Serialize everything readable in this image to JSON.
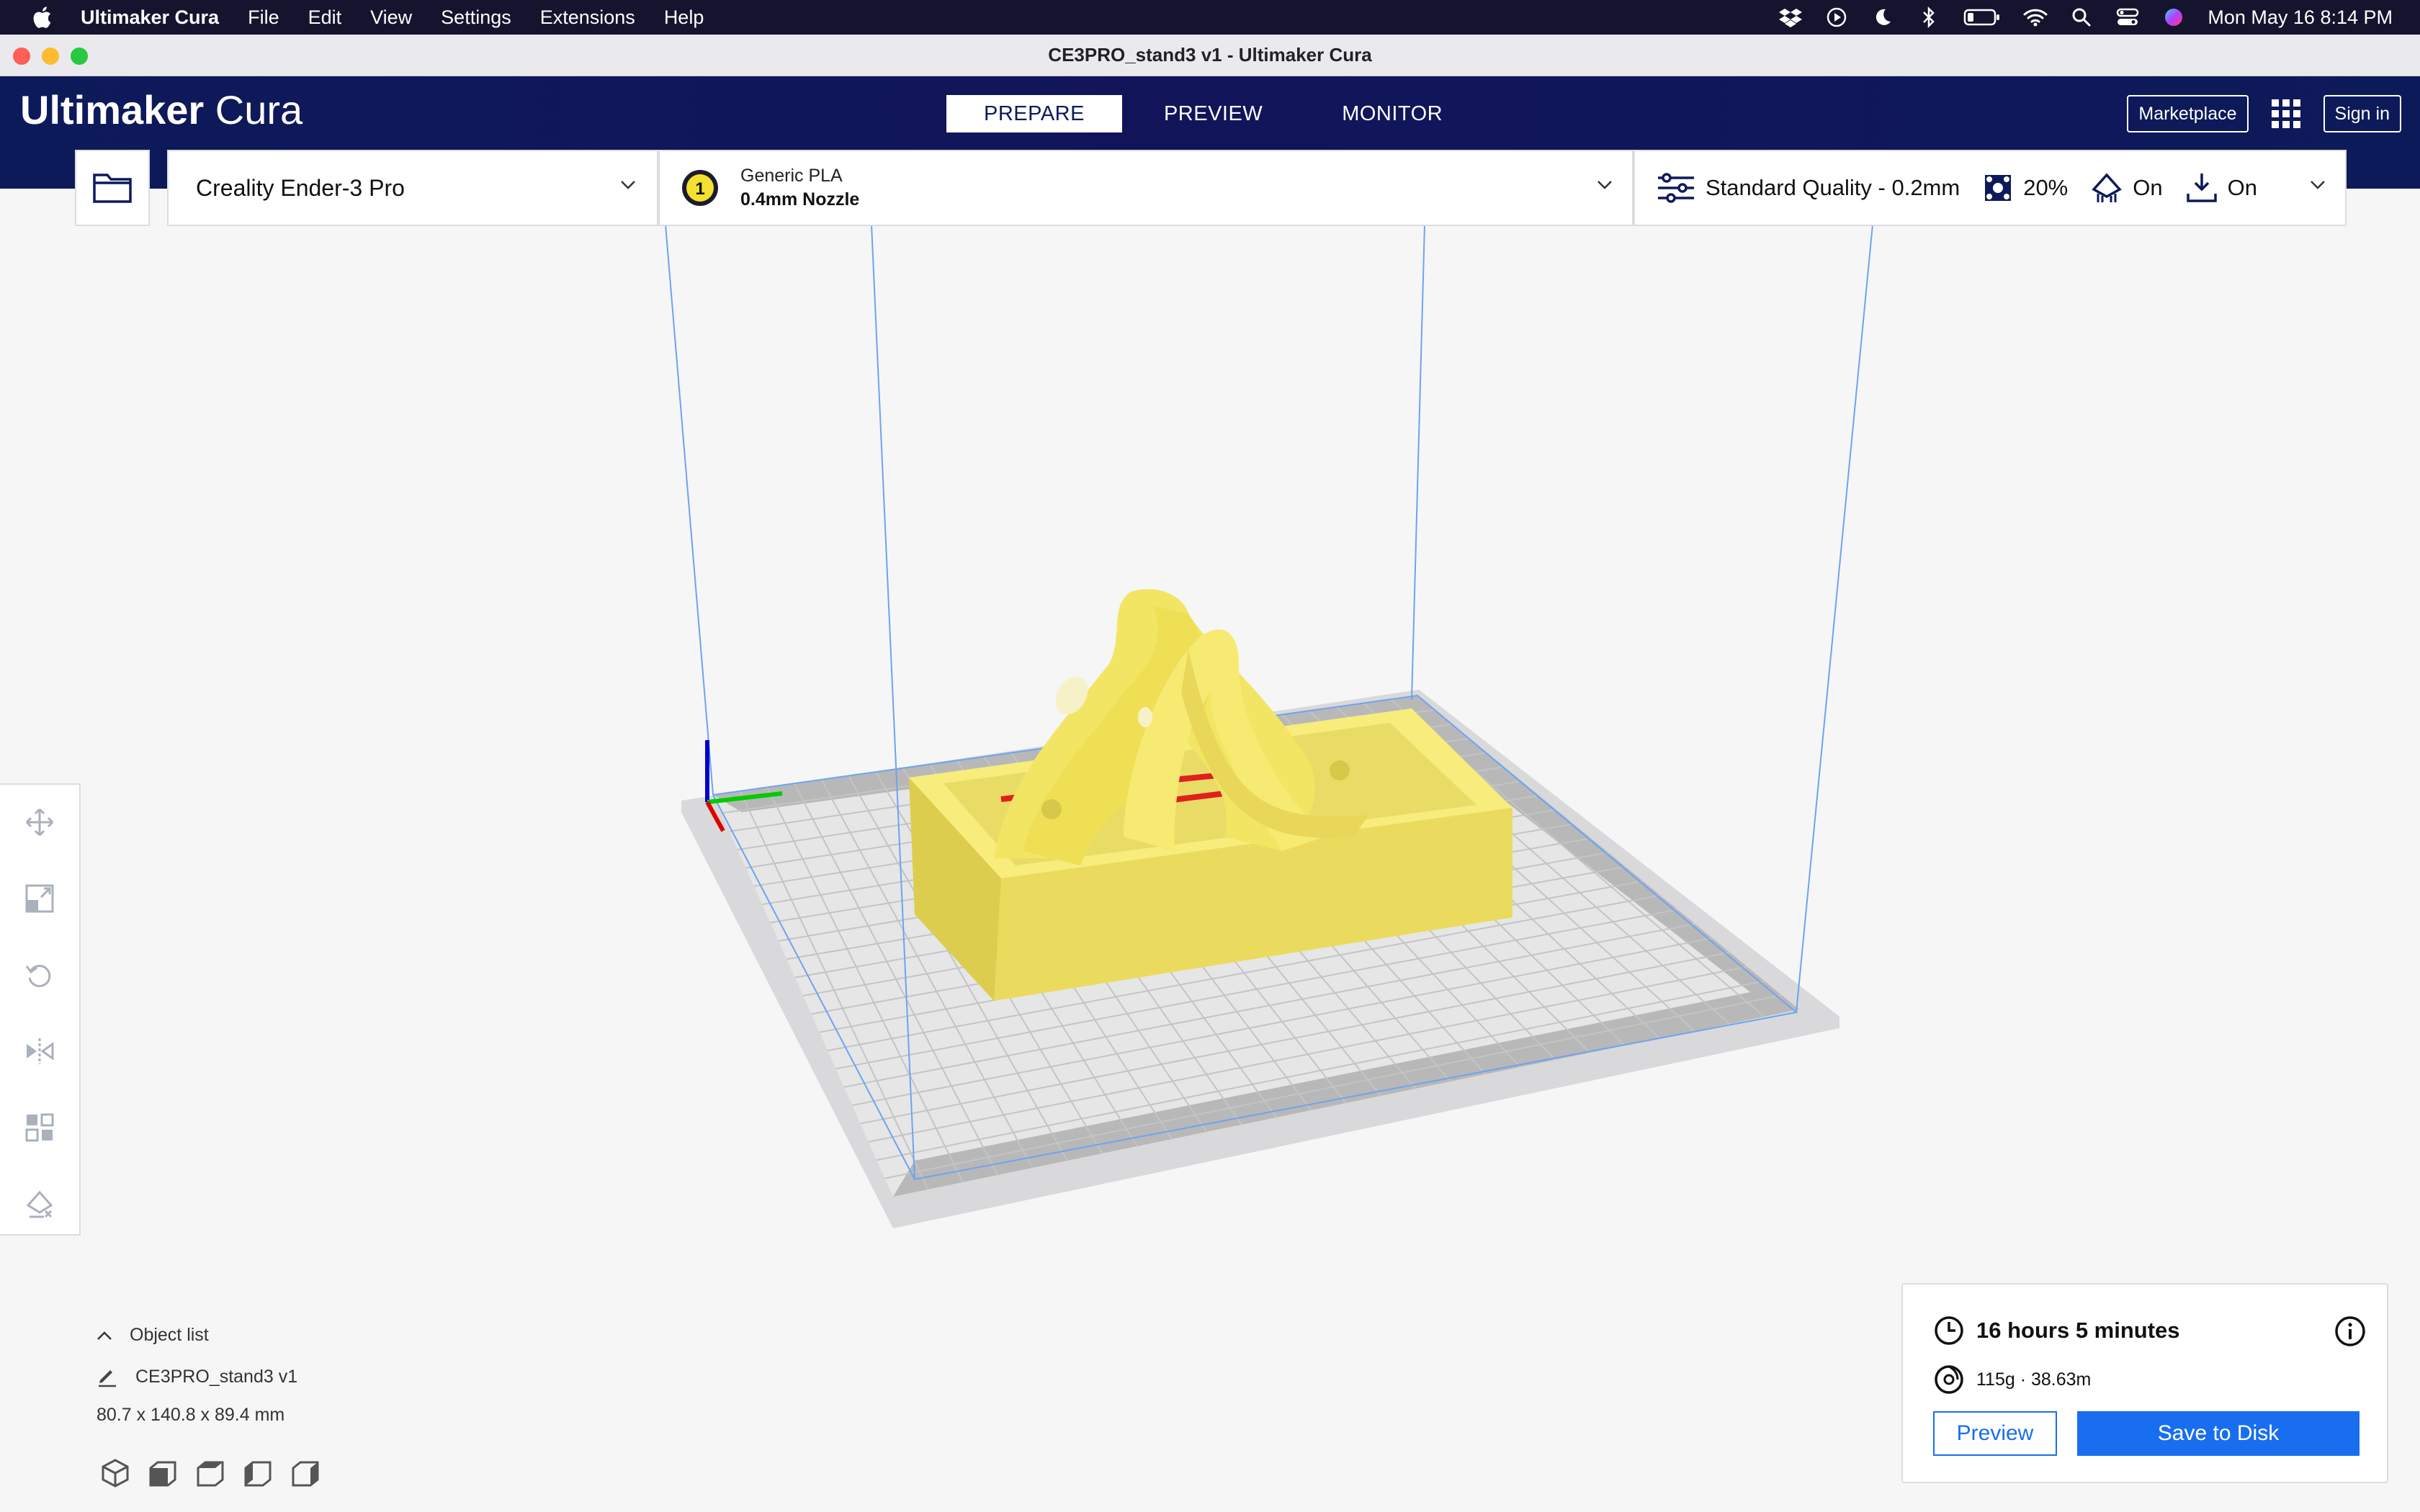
{
  "menubar": {
    "app_name": "Ultimaker Cura",
    "items": [
      "File",
      "Edit",
      "View",
      "Settings",
      "Extensions",
      "Help"
    ],
    "clock": "Mon May 16  8:14 PM"
  },
  "window": {
    "title": "CE3PRO_stand3 v1 - Ultimaker Cura"
  },
  "header": {
    "logo_bold": "Ultimaker",
    "logo_light": " Cura",
    "tabs": [
      {
        "label": "PREPARE",
        "active": true
      },
      {
        "label": "PREVIEW",
        "active": false
      },
      {
        "label": "MONITOR",
        "active": false
      }
    ],
    "marketplace_label": "Marketplace",
    "signin_label": "Sign in"
  },
  "toolbar": {
    "printer": "Creality Ender-3 Pro",
    "extruder_number": "1",
    "material": "Generic PLA",
    "nozzle": "0.4mm Nozzle",
    "quality": "Standard Quality - 0.2mm",
    "infill": "20%",
    "support": "On",
    "adhesion": "On"
  },
  "object_list": {
    "toggle_label": "Object list",
    "object_name": "CE3PRO_stand3 v1",
    "dimensions": "80.7 x 140.8 x 89.4 mm"
  },
  "action_panel": {
    "print_time": "16 hours 5 minutes",
    "material_usage": "115g · 38.63m",
    "preview_label": "Preview",
    "save_label": "Save to Disk"
  },
  "colors": {
    "header_bg": "#0d1a5a",
    "accent_blue": "#196ef0",
    "model_yellow": "#f4e96a",
    "viewport_bg": "#f6f6f6"
  }
}
